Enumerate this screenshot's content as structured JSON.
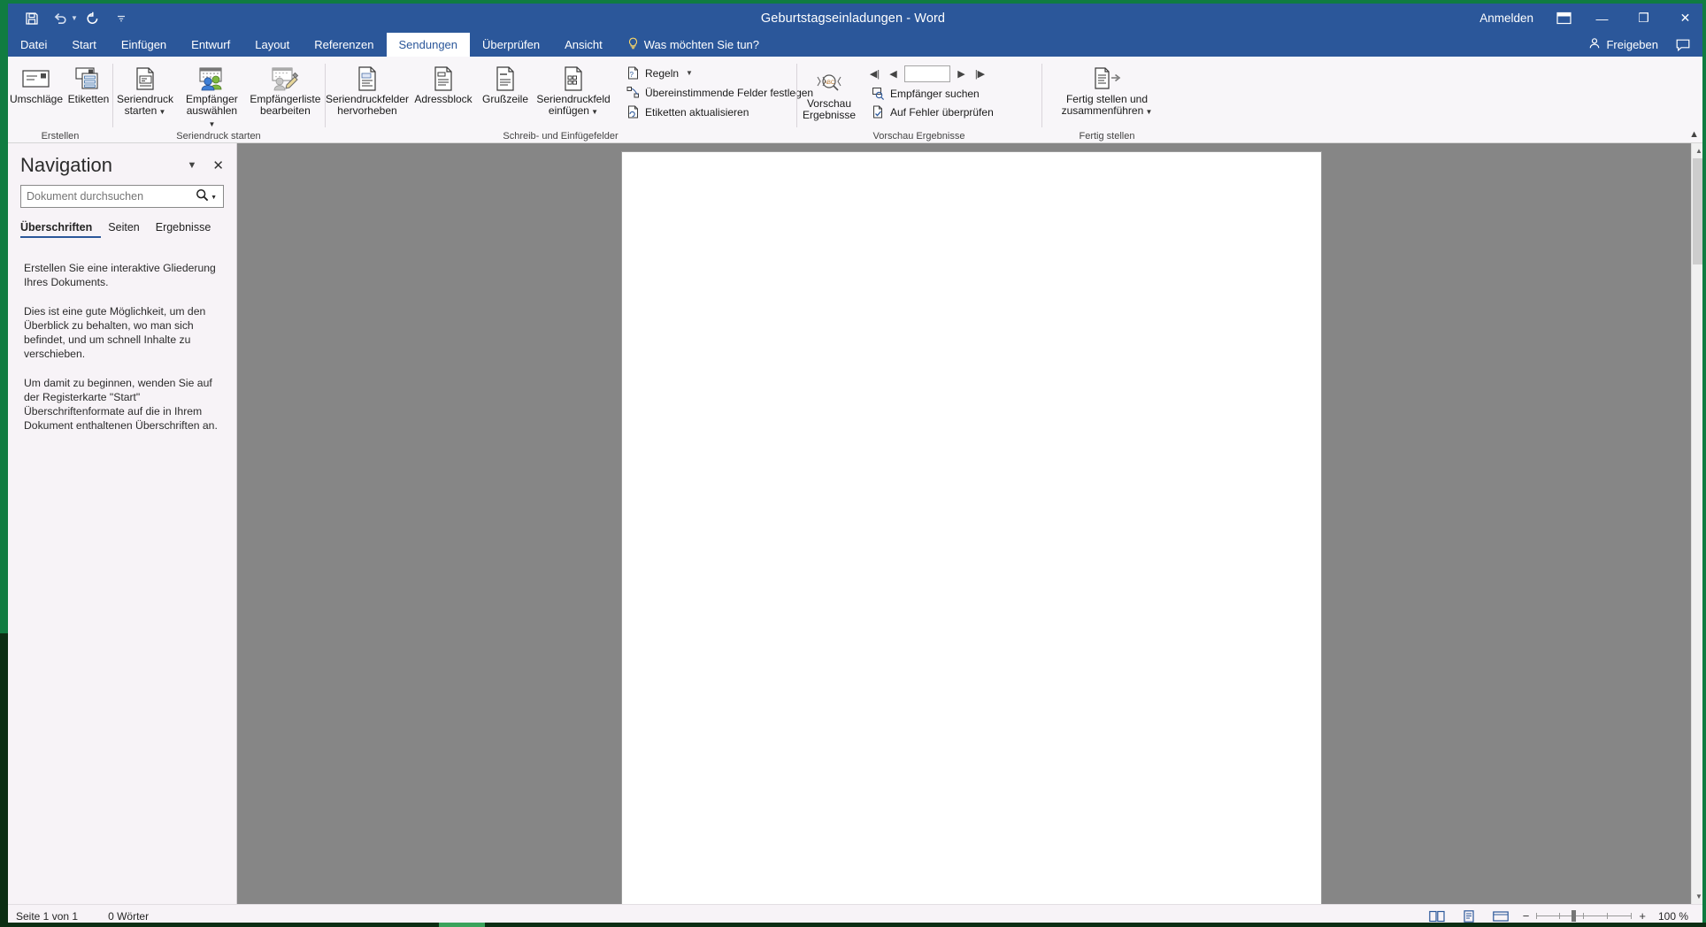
{
  "window": {
    "title": "Geburtstagseinladungen  -  Word",
    "signin_label": "Anmelden",
    "minimize": "—",
    "maximize": "❐",
    "close": "✕",
    "quick_access": {
      "save": "save-icon",
      "undo": "undo-icon",
      "redo": "redo-icon",
      "customize": "customize-qat-icon"
    },
    "ribbon_display_options": "ribbon-display-options-icon",
    "share_label": "Freigeben",
    "comments_icon": "comments-icon"
  },
  "tabs": [
    {
      "label": "Datei",
      "active": false
    },
    {
      "label": "Start",
      "active": false
    },
    {
      "label": "Einfügen",
      "active": false
    },
    {
      "label": "Entwurf",
      "active": false
    },
    {
      "label": "Layout",
      "active": false
    },
    {
      "label": "Referenzen",
      "active": false
    },
    {
      "label": "Sendungen",
      "active": true
    },
    {
      "label": "Überprüfen",
      "active": false
    },
    {
      "label": "Ansicht",
      "active": false
    }
  ],
  "tell_me": {
    "icon": "lightbulb-icon",
    "placeholder": "Was möchten Sie tun?"
  },
  "ribbon": {
    "collapse_icon": "collapse-ribbon-icon",
    "groups": [
      {
        "name": "Erstellen",
        "label": "Erstellen",
        "buttons": [
          {
            "label": "Umschläge",
            "icon": "envelope-icon",
            "dropdown": false
          },
          {
            "label": "Etiketten",
            "icon": "labels-icon",
            "dropdown": false
          }
        ]
      },
      {
        "name": "Seriendruck starten",
        "label": "Seriendruck starten",
        "buttons": [
          {
            "label": "Seriendruck\nstarten",
            "icon": "start-mailmerge-icon",
            "dropdown": true
          },
          {
            "label": "Empfänger\nauswählen",
            "icon": "select-recipients-icon",
            "dropdown": true
          },
          {
            "label": "Empfängerliste\nbearbeiten",
            "icon": "edit-recipients-icon",
            "dropdown": false
          }
        ]
      },
      {
        "name": "Schreib- und Einfügefelder",
        "label": "Schreib- und Einfügefelder",
        "buttons": [
          {
            "label": "Seriendruckfelder\nhervorheben",
            "icon": "highlight-merge-fields-icon",
            "dropdown": false
          },
          {
            "label": "Adressblock",
            "icon": "address-block-icon",
            "dropdown": false
          },
          {
            "label": "Grußzeile",
            "icon": "greeting-line-icon",
            "dropdown": false
          },
          {
            "label": "Seriendruckfeld\neinfügen",
            "icon": "insert-merge-field-icon",
            "dropdown": true
          }
        ],
        "small_buttons": [
          {
            "label": "Regeln",
            "icon": "rules-icon",
            "dropdown": true
          },
          {
            "label": "Übereinstimmende Felder festlegen",
            "icon": "match-fields-icon",
            "dropdown": false
          },
          {
            "label": "Etiketten aktualisieren",
            "icon": "update-labels-icon",
            "dropdown": false
          }
        ]
      },
      {
        "name": "Vorschau Ergebnisse",
        "label": "Vorschau Ergebnisse",
        "buttons": [
          {
            "label": "Vorschau\nErgebnisse",
            "icon": "preview-results-icon",
            "dropdown": false
          }
        ],
        "record_nav": {
          "first": "first-record-icon",
          "prev": "previous-record-icon",
          "value": "",
          "next": "next-record-icon",
          "last": "last-record-icon"
        },
        "small_buttons": [
          {
            "label": "Empfänger suchen",
            "icon": "find-recipient-icon",
            "dropdown": false
          },
          {
            "label": "Auf Fehler überprüfen",
            "icon": "check-errors-icon",
            "dropdown": false
          }
        ]
      },
      {
        "name": "Fertig stellen",
        "label": "Fertig stellen",
        "buttons": [
          {
            "label": "Fertig stellen und\nzusammenführen",
            "icon": "finish-merge-icon",
            "dropdown": true
          }
        ]
      }
    ]
  },
  "navigation_pane": {
    "title": "Navigation",
    "options_icon": "chevron-down-icon",
    "close_icon": "close-icon",
    "search": {
      "placeholder": "Dokument durchsuchen",
      "value": "",
      "icon": "search-icon",
      "dropdown_icon": "chevron-down-icon"
    },
    "tabs": [
      {
        "label": "Überschriften",
        "active": true
      },
      {
        "label": "Seiten",
        "active": false
      },
      {
        "label": "Ergebnisse",
        "active": false
      }
    ],
    "paragraphs": [
      "Erstellen Sie eine interaktive Gliederung Ihres Dokuments.",
      "Dies ist eine gute Möglichkeit, um den Überblick zu behalten, wo man sich befindet, und um schnell Inhalte zu verschieben.",
      "Um damit zu beginnen, wenden Sie auf der Registerkarte \"Start\" Überschriftenformate auf die in Ihrem Dokument enthaltenen Überschriften an."
    ]
  },
  "status_bar": {
    "page_info": "Seite 1 von 1",
    "word_count": "0 Wörter",
    "views": [
      {
        "name": "read-mode-view",
        "icon": "read-mode-icon"
      },
      {
        "name": "print-layout-view",
        "icon": "print-layout-icon"
      },
      {
        "name": "web-layout-view",
        "icon": "web-layout-icon"
      }
    ],
    "zoom_out": "−",
    "zoom_in": "+",
    "zoom_level": "100 %"
  },
  "colors": {
    "title_bar": "#2b579a",
    "ribbon_bg": "#f8f6f9",
    "accent": "#2b579a",
    "window_border": "#107c41",
    "canvas": "#868686"
  }
}
